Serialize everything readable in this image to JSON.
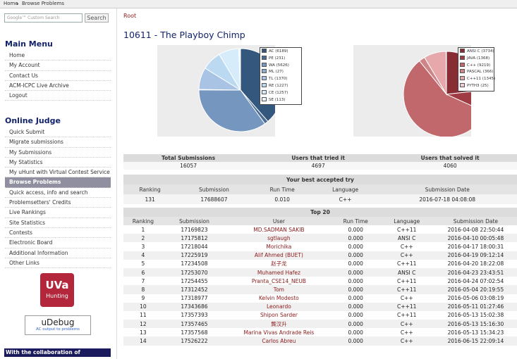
{
  "topbar": {
    "home": "Home",
    "sep": "▸",
    "current": "Browse Problems"
  },
  "sidebar": {
    "search_placeholder": "Google™ Custom Search",
    "search_button": "Search",
    "main_menu_title": "Main Menu",
    "main_menu": [
      "Home",
      "My Account",
      "Contact Us",
      "ACM-ICPC Live Archive",
      "Logout"
    ],
    "online_judge_title": "Online Judge",
    "online_judge": [
      "Quick Submit",
      "Migrate submissions",
      "My Submissions",
      "My Statistics",
      "My uHunt with Virtual Contest Service",
      "Browse Problems",
      "Quick access, info and search",
      "Problemsetters' Credits",
      "Live Rankings",
      "Site Statistics",
      "Contests",
      "Electronic Board",
      "Additional Information",
      "Other Links"
    ],
    "active_item": "Browse Problems",
    "uva_logo": {
      "big": "UVa",
      "small": "Hunting"
    },
    "udebug": {
      "title": "uDebug",
      "subtitle": "AC output to problems"
    },
    "collab": "With the collaboration of"
  },
  "main": {
    "breadcrumb": "Root",
    "title": "10611 - The Playboy Chimp",
    "verdict_chart": {
      "legend": [
        "AC (6189)",
        "PE (231)",
        "WA (5626)",
        "ML (27)",
        "TL (1370)",
        "RE (1227)",
        "CE (1257)",
        "SE (113)"
      ],
      "values": [
        6189,
        231,
        5626,
        27,
        1370,
        1227,
        1257,
        113
      ],
      "colors": [
        "#34577e",
        "#4a6b92",
        "#7596bf",
        "#8faacb",
        "#a8c3e3",
        "#bcd9f2",
        "#d7ecfa",
        "#eef7fd"
      ]
    },
    "language_chart": {
      "legend": [
        "ANSI C (3734)",
        "JAVA (1368)",
        "C++ (9219)",
        "PASCAL (366)",
        "C++11 (1345)",
        "PYTH3 (25)"
      ],
      "values": [
        3734,
        1368,
        9219,
        366,
        1345,
        25
      ],
      "colors": [
        "#892d35",
        "#9f3c43",
        "#c0686b",
        "#cf8488",
        "#e6a8aa",
        "#f3cfd0"
      ]
    },
    "stats": {
      "headers": [
        "Total Submissions",
        "Users that tried it",
        "Users that solved it"
      ],
      "values": [
        "16057",
        "4697",
        "4060"
      ]
    },
    "best": {
      "title": "Your best accepted try",
      "headers": [
        "Ranking",
        "Submission",
        "Run Time",
        "Language",
        "Submission Date"
      ],
      "row": [
        "131",
        "17688607",
        "0.010",
        "C++",
        "2016-07-18 04:08:08"
      ]
    },
    "top20": {
      "title": "Top 20",
      "headers": [
        "Ranking",
        "Submission",
        "User",
        "Run Time",
        "Language",
        "Submission Date"
      ],
      "rows": [
        [
          "1",
          "17169823",
          "MD.SADMAN SAKIB",
          "0.000",
          "C++11",
          "2016-04-08 22:50:44"
        ],
        [
          "2",
          "17175812",
          "sgtlaugh",
          "0.000",
          "ANSI C",
          "2016-04-10 00:05:48"
        ],
        [
          "3",
          "17218044",
          "Morichika",
          "0.000",
          "C++",
          "2016-04-17 18:00:31"
        ],
        [
          "4",
          "17225919",
          "Alif Ahmed (BUET)",
          "0.000",
          "C++",
          "2016-04-19 09:12:14"
        ],
        [
          "5",
          "17234508",
          "赵子龙",
          "0.000",
          "C++11",
          "2016-04-20 18:22:08"
        ],
        [
          "6",
          "17253070",
          "Muhamed Hafez",
          "0.000",
          "ANSI C",
          "2016-04-23 23:43:51"
        ],
        [
          "7",
          "17254455",
          "Pranta_CSE14_NEUB",
          "0.000",
          "C++11",
          "2016-04-24 07:02:54"
        ],
        [
          "8",
          "17312452",
          "Tom",
          "0.000",
          "C++11",
          "2016-05-04 20:19:55"
        ],
        [
          "9",
          "17318977",
          "Kelvin Modesto",
          "0.000",
          "C++",
          "2016-05-06 03:08:19"
        ],
        [
          "10",
          "17343686",
          "Leonardo",
          "0.000",
          "C++11",
          "2016-05-11 01:27:46"
        ],
        [
          "11",
          "17357393",
          "Shipon Sarder",
          "0.000",
          "C++11",
          "2016-05-13 15:02:38"
        ],
        [
          "12",
          "17357465",
          "龔汉升",
          "0.000",
          "C++",
          "2016-05-13 15:16:30"
        ],
        [
          "13",
          "17357568",
          "Marina Vivas Andrade Reis",
          "0.000",
          "C++",
          "2016-05-13 15:34:23"
        ],
        [
          "14",
          "17526222",
          "Carlos Abreu",
          "0.000",
          "C++",
          "2016-06-15 22:09:14"
        ]
      ]
    }
  }
}
